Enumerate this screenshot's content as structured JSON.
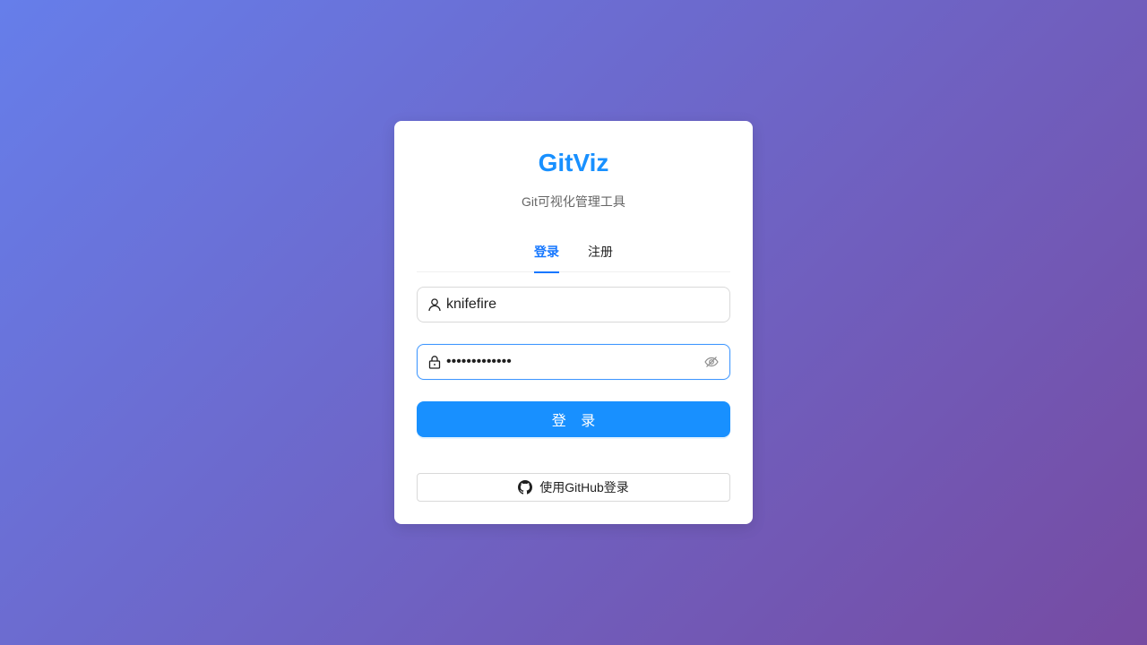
{
  "app": {
    "title": "GitViz",
    "subtitle": "Git可视化管理工具"
  },
  "tabs": [
    {
      "label": "登录",
      "active": true
    },
    {
      "label": "注册",
      "active": false
    }
  ],
  "form": {
    "username": {
      "value": "knifefire",
      "icon": "user-icon"
    },
    "password": {
      "value": "•••••••••••••",
      "icon": "lock-icon",
      "toggle_icon": "eye-invisible-icon"
    },
    "submit_label": "登 录",
    "github_label": "使用GitHub登录",
    "github_icon": "github-icon"
  },
  "colors": {
    "accent": "#1890ff",
    "tab_active": "#1677ff",
    "background_start": "#667eea",
    "background_end": "#764ba2"
  }
}
